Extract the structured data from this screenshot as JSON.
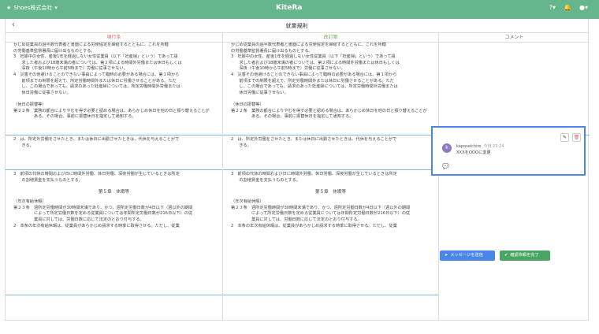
{
  "topbar": {
    "company": "Shoes株式会社",
    "company_caret": "▾",
    "logo": "KiteRa",
    "help": "?",
    "help_caret": "▾",
    "bell": "🔔",
    "user": "●",
    "user_caret": "▾"
  },
  "titlebar": {
    "back": "‹",
    "title": "就業規則"
  },
  "columns": {
    "current": "現行条",
    "revised": "改訂案",
    "comments": "コメント"
  },
  "current": {
    "top": [
      "かじめ従業員の過半数代表者と書面による労使協定を締結するとともに、これを所轄",
      "の労働基準監督署長に届け出るものとする。",
      "3　妊娠中の女性、産後1年を経過しない女性従業員（以下「妊産婦」という）であって請",
      "　　求した者および18歳未満の者については、第２項による時間外労働または休日もしくは",
      "　　深夜（午後10時から午前5時まで）労働に従事させない。",
      "4　災害その他避けることのできない事由によって臨時の必要がある場合には、第１項から",
      "　　前項までの制限を超えて、所定労働時間外または休日に労働させることがある。ただ",
      "　　し、この場合であっても、請求のあった妊産婦については、所定労働時間外労働または",
      "　　休日労働に従事させない。",
      "",
      "（休日の振替等）",
      "第２２条　業務の都合によりやむを得ず必要と認める場合は、あらかじめ休日を他の日と振り替えることが",
      "　　　　　ある。その場合、事前に振替休日を指定して通知する。"
    ],
    "mid": [
      "2　は、所定外労働をさせたとき、または休日に出勤させたときは、代休を与えることがで",
      "　　きる。"
    ],
    "bottom": [
      "3　前項の代休の時間および日に時間外労働、休日労働、深夜労働が生じているときは所定",
      "　　の割増賃金を支払うものとする。"
    ],
    "chapter": "第５章　休暇等",
    "tail": [
      "（年次有給休暇）",
      "第２３条　週所定労働時間が30時間未満であり、かつ、週所定労働日数が4日以下（週以外の期間",
      "　　　　　によって所定労働日数を定める従業員については年間所定労働日数が216日以下）の従",
      "　　　　　業員に対しては、労働日数に応じて法定のとおり付与する。",
      "2　本条の年次有給休暇は、従業員があらかじめ請求する時季に取得させる。ただし、従業"
    ]
  },
  "revised": {
    "top": [
      "かじめ従業員の過半数代表者と書面による労使協定を締結するとともに、これを所轄",
      "の労働基準監督署長に届け出るものとする。",
      "3　妊娠中の女性、産後1年を経過しない女性従業員（以下「妊産婦」という）であって請",
      "　　求した者および18歳未満の者については、第２項による時間外労働または休日もしくは",
      "　　深夜（午後10時から午前5時まで）労働に従事させない。",
      "4　災害その他避けることのできない事由によって臨時の必要がある場合には、第１項から",
      "　　前項までの制限を超えて、所定労働時間外または休日に労働させることがある。ただ",
      "　　し、この場合であっても、請求のあった妊産婦については、所定労働時間外労働または",
      "　　休日労働に従事させない。",
      "",
      "（休日の振替等）",
      "第２２条　業務の都合によりやむを得ず必要と認める場合は、あらかじめ休日を他の日と振り替えることが",
      "　　　　　ある。その場合、事前に振替休日を指定して通知する。"
    ],
    "mid": [
      "2　は、所定外労働をさせたとき、または休日に出勤させたときは、代休を与えることがで",
      "　　きる。"
    ],
    "bottom": [
      "3　前項の代休の時間および日に時間外労働、休日労働、深夜労働が生じているときは所定",
      "　　の割増賃金を支払うものとする。"
    ],
    "chapter": "第５章　休暇等",
    "tail": [
      "（年次有給休暇）",
      "第２３条　週所定労働時間が30時間未満であり、かつ、週所定労働日数が4日以下（週以外の期間",
      "　　　　　によって所定労働日数を定める従業員については年間所定労働日数が216日以下）の従",
      "　　　　　業員に対しては、労働日数に応じて法定のとおり付与する。",
      "2　本条の年次有給休暇は、従業員があらかじめ請求する時季に取得させる。ただし、従業"
    ]
  },
  "comment": {
    "avatar": "k",
    "user": "kaposeichiro",
    "time": "今日 23:24",
    "body": "XXXをOOOに変更",
    "edit": "✎",
    "delete": "🗑",
    "note": "💬"
  },
  "actions": {
    "send": "メッセージを送信",
    "confirm": "確認依頼を完了",
    "send_icon": "➤",
    "confirm_icon": "✔"
  },
  "colors": {
    "topbar": "#65b68c",
    "highlight": "#4a86e8",
    "confirm": "#4aa564"
  }
}
